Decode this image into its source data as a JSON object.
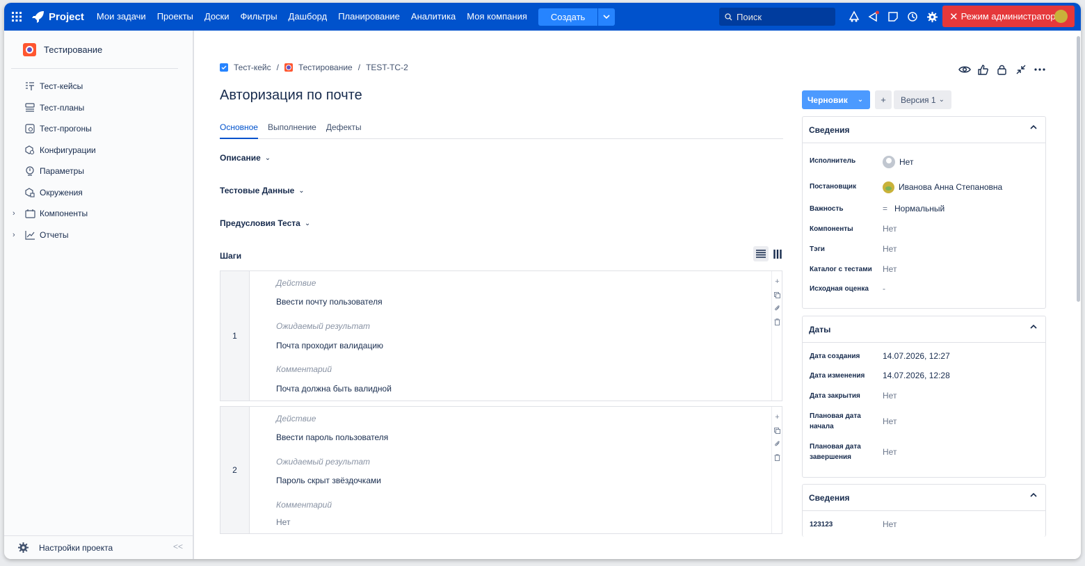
{
  "topbar": {
    "app_name": "Project",
    "nav": [
      "Мои задачи",
      "Проекты",
      "Доски",
      "Фильтры",
      "Дашборд",
      "Планирование",
      "Аналитика",
      "Моя компания"
    ],
    "create_label": "Создать",
    "search_placeholder": "Поиск",
    "admin_label": "Режим администратора",
    "icons": [
      "grid-icon",
      "rocket-icon",
      "bell-icon",
      "megaphone-icon",
      "notes-icon",
      "history-icon",
      "gear-icon"
    ]
  },
  "sidebar": {
    "project_name": "Тестирование",
    "items": [
      {
        "label": "Тест-кейсы",
        "icon": "test-cases-icon",
        "expandable": false
      },
      {
        "label": "Тест-планы",
        "icon": "test-plans-icon",
        "expandable": false
      },
      {
        "label": "Тест-прогоны",
        "icon": "test-runs-icon",
        "expandable": false
      },
      {
        "label": "Конфигурации",
        "icon": "configurations-icon",
        "expandable": false
      },
      {
        "label": "Параметры",
        "icon": "parameters-icon",
        "expandable": false
      },
      {
        "label": "Окружения",
        "icon": "environments-icon",
        "expandable": false
      },
      {
        "label": "Компоненты",
        "icon": "components-icon",
        "expandable": true
      },
      {
        "label": "Отчеты",
        "icon": "reports-icon",
        "expandable": true
      }
    ],
    "settings_label": "Настройки проекта",
    "collapse_glyph": "<<"
  },
  "breadcrumb": {
    "type": "Тест-кейс",
    "project": "Тестирование",
    "key": "TEST-TC-2"
  },
  "issue": {
    "title": "Авторизация по почте",
    "tabs": [
      "Основное",
      "Выполнение",
      "Дефекты"
    ],
    "active_tab": "Основное",
    "sections": {
      "description": "Описание",
      "test_data": "Тестовые Данные",
      "preconditions": "Предусловия Теста",
      "steps": "Шаги"
    },
    "steps": [
      {
        "number": "1",
        "action_label": "Действие",
        "action": "Ввести почту пользователя",
        "expected_label": "Ожидаемый результат",
        "expected": "Почта проходит валидацию",
        "comment_label": "Комментарий",
        "comment": "Почта должна быть валидной"
      },
      {
        "number": "2",
        "action_label": "Действие",
        "action": "Ввести пароль пользователя",
        "expected_label": "Ожидаемый результат",
        "expected": "Пароль скрыт звёздочками",
        "comment_label": "Комментарий",
        "comment": "Нет"
      }
    ]
  },
  "right": {
    "status": "Черновик",
    "plus": "+",
    "version": "Версия 1",
    "details": {
      "title": "Сведения",
      "rows": [
        {
          "key": "Исполнитель",
          "value": "Нет"
        },
        {
          "key": "Постановщик",
          "value": "Иванова Анна Степановна"
        },
        {
          "key": "Важность",
          "value": "Нормальный"
        },
        {
          "key": "Компоненты",
          "value": "Нет"
        },
        {
          "key": "Тэги",
          "value": "Нет"
        },
        {
          "key": "Каталог с тестами",
          "value": "Нет"
        },
        {
          "key": "Исходная оценка",
          "value": "-"
        }
      ]
    },
    "dates": {
      "title": "Даты",
      "rows": [
        {
          "key": "Дата создания",
          "value": "14.07.2026, 12:27"
        },
        {
          "key": "Дата изменения",
          "value": "14.07.2026, 12:28"
        },
        {
          "key": "Дата закрытия",
          "value": "Нет"
        },
        {
          "key": "Плановая дата начала",
          "value": "Нет"
        },
        {
          "key": "Плановая дата завершения",
          "value": "Нет"
        }
      ]
    },
    "extra": {
      "title": "Сведения",
      "rows": [
        {
          "key": "123123",
          "value": "Нет"
        }
      ]
    }
  },
  "colors": {
    "topbar": "#0052cc",
    "create": "#2684ff",
    "admin": "#e5383b",
    "status": "#4c9aff",
    "active_tab": "#0052cc"
  }
}
